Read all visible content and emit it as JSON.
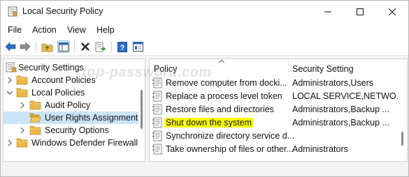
{
  "window": {
    "title": "Local Security Policy",
    "controls": {
      "minimize": "minimize",
      "maximize": "maximize",
      "close": "close"
    }
  },
  "menu": [
    "File",
    "Action",
    "View",
    "Help"
  ],
  "toolbar": [
    "back-arrow-icon",
    "forward-arrow-icon",
    "up-folder-icon",
    "show-hide-tree-icon",
    "delete-icon",
    "export-list-icon",
    "help-icon",
    "properties-icon"
  ],
  "tree": {
    "items": [
      {
        "label": "Security Settings",
        "level": 0,
        "expanded": true
      },
      {
        "label": "Account Policies",
        "level": 1,
        "expanded": false
      },
      {
        "label": "Local Policies",
        "level": 1,
        "expanded": true
      },
      {
        "label": "Audit Policy",
        "level": 2,
        "expanded": false
      },
      {
        "label": "User Rights Assignment",
        "level": 2,
        "selected": true
      },
      {
        "label": "Security Options",
        "level": 2,
        "expanded": false
      },
      {
        "label": "Windows Defender Firewall",
        "level": 1,
        "expanded": false
      }
    ]
  },
  "list": {
    "columns": {
      "policy": "Policy",
      "setting": "Security Setting"
    },
    "rows": [
      {
        "policy": "Remove computer from docki...",
        "setting": "Administrators,Users"
      },
      {
        "policy": "Replace a process level token",
        "setting": "LOCAL SERVICE,NETWO..."
      },
      {
        "policy": "Restore files and directories",
        "setting": "Administrators,Backup ..."
      },
      {
        "policy": "Shut down the system",
        "setting": "Administrators,Backup ...",
        "highlighted": true
      },
      {
        "policy": "Synchronize directory service d...",
        "setting": ""
      },
      {
        "policy": "Take ownership of files or other...",
        "setting": "Administrators"
      }
    ]
  },
  "watermark": "top-password.com",
  "colors": {
    "selection": "#cce4f7",
    "highlight": "#ffff00",
    "folder": "#e8b84a",
    "accent": "#2b6cc4"
  }
}
